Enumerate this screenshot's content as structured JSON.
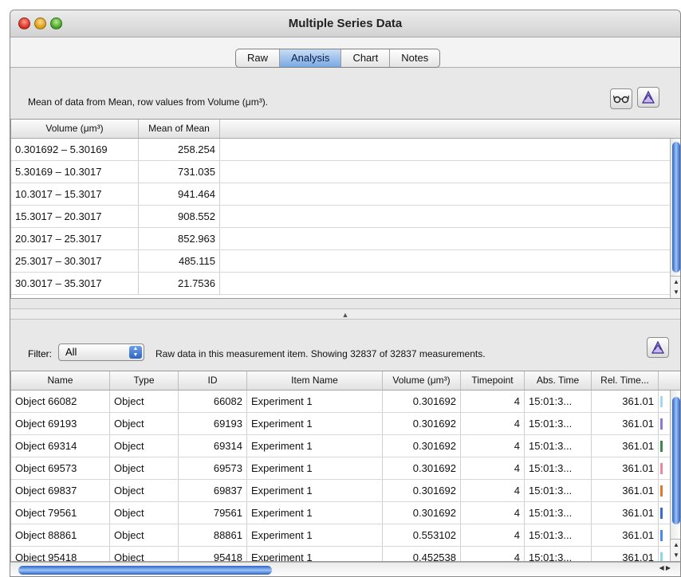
{
  "window": {
    "title": "Multiple Series Data"
  },
  "tabs": [
    {
      "label": "Raw"
    },
    {
      "label": "Analysis"
    },
    {
      "label": "Chart"
    },
    {
      "label": "Notes"
    }
  ],
  "active_tab": "Analysis",
  "analysis": {
    "description": "Mean of data from Mean, row values from Volume (μm³).",
    "columns": [
      "Volume (μm³)",
      "Mean of Mean"
    ],
    "rows": [
      {
        "volume": "0.301692 – 5.30169",
        "mean": "258.254"
      },
      {
        "volume": "5.30169 – 10.3017",
        "mean": "731.035"
      },
      {
        "volume": "10.3017 – 15.3017",
        "mean": "941.464"
      },
      {
        "volume": "15.3017 – 20.3017",
        "mean": "908.552"
      },
      {
        "volume": "20.3017 – 25.3017",
        "mean": "852.963"
      },
      {
        "volume": "25.3017 – 30.3017",
        "mean": "485.115"
      },
      {
        "volume": "30.3017 – 35.3017",
        "mean": "21.7536"
      }
    ]
  },
  "filter": {
    "label": "Filter:",
    "value": "All",
    "status": "Raw data in this measurement item.  Showing 32837 of 32837 measurements."
  },
  "raw": {
    "columns": [
      "Name",
      "Type",
      "ID",
      "Item Name",
      "Volume (μm³)",
      "Timepoint",
      "Abs. Time",
      "Rel. Time..."
    ],
    "rows": [
      {
        "name": "Object 66082",
        "type": "Object",
        "id": "66082",
        "item": "Experiment 1",
        "volume": "0.301692",
        "tp": "4",
        "abs": "15:01:3...",
        "rel": "361.01",
        "color": "#a8d8f0"
      },
      {
        "name": "Object 69193",
        "type": "Object",
        "id": "69193",
        "item": "Experiment 1",
        "volume": "0.301692",
        "tp": "4",
        "abs": "15:01:3...",
        "rel": "361.01",
        "color": "#8a7ad8"
      },
      {
        "name": "Object 69314",
        "type": "Object",
        "id": "69314",
        "item": "Experiment 1",
        "volume": "0.301692",
        "tp": "4",
        "abs": "15:01:3...",
        "rel": "361.01",
        "color": "#3a8a4a"
      },
      {
        "name": "Object 69573",
        "type": "Object",
        "id": "69573",
        "item": "Experiment 1",
        "volume": "0.301692",
        "tp": "4",
        "abs": "15:01:3...",
        "rel": "361.01",
        "color": "#e88a9a"
      },
      {
        "name": "Object 69837",
        "type": "Object",
        "id": "69837",
        "item": "Experiment 1",
        "volume": "0.301692",
        "tp": "4",
        "abs": "15:01:3...",
        "rel": "361.01",
        "color": "#e07a2a"
      },
      {
        "name": "Object 79561",
        "type": "Object",
        "id": "79561",
        "item": "Experiment 1",
        "volume": "0.301692",
        "tp": "4",
        "abs": "15:01:3...",
        "rel": "361.01",
        "color": "#3a6ad8"
      },
      {
        "name": "Object 88861",
        "type": "Object",
        "id": "88861",
        "item": "Experiment 1",
        "volume": "0.553102",
        "tp": "4",
        "abs": "15:01:3...",
        "rel": "361.01",
        "color": "#4a8ae8"
      },
      {
        "name": "Object 95418",
        "type": "Object",
        "id": "95418",
        "item": "Experiment 1",
        "volume": "0.452538",
        "tp": "4",
        "abs": "15:01:3...",
        "rel": "361.01",
        "color": "#8ad8e8"
      }
    ]
  },
  "icons": {
    "glasses": "glasses-icon",
    "export": "export-icon"
  }
}
